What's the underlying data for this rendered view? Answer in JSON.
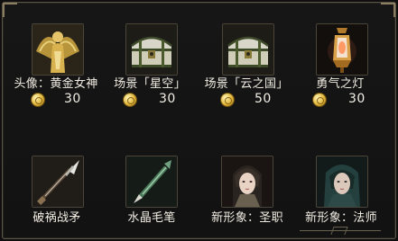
{
  "items_row1": [
    {
      "label": "头像：黄金女神",
      "price": "30",
      "icon": "golden-goddess-icon"
    },
    {
      "label": "场景「星空」",
      "price": "30",
      "icon": "treasure-chest-icon"
    },
    {
      "label": "场景「云之国」",
      "price": "50",
      "icon": "treasure-chest-icon"
    },
    {
      "label": "勇气之灯",
      "price": "30",
      "icon": "lantern-icon"
    }
  ],
  "items_row2": [
    {
      "label": "破祸战矛",
      "icon": "spear-icon"
    },
    {
      "label": "水晶毛笔",
      "icon": "crystal-brush-icon"
    },
    {
      "label": "新形象：圣职",
      "icon": "priestess-portrait-icon"
    },
    {
      "label": "新形象：法师",
      "icon": "mage-portrait-icon"
    }
  ],
  "currency_icon": "gold-coin-icon",
  "colors": {
    "background": "#121212",
    "border": "#5a5446",
    "coin": "#e1b53b"
  }
}
